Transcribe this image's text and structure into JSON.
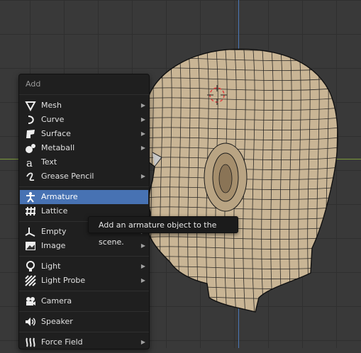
{
  "menu": {
    "title": "Add",
    "items": [
      {
        "label": "Mesh",
        "icon": "mesh-icon",
        "submenu": true
      },
      {
        "label": "Curve",
        "icon": "curve-icon",
        "submenu": true
      },
      {
        "label": "Surface",
        "icon": "surface-icon",
        "submenu": true
      },
      {
        "label": "Metaball",
        "icon": "metaball-icon",
        "submenu": true
      },
      {
        "label": "Text",
        "icon": "text-icon",
        "submenu": false
      },
      {
        "label": "Grease Pencil",
        "icon": "grease-pencil-icon",
        "submenu": true
      },
      {
        "label": "Armature",
        "icon": "armature-icon",
        "submenu": false,
        "selected": true
      },
      {
        "label": "Lattice",
        "icon": "lattice-icon",
        "submenu": false
      },
      {
        "label": "Empty",
        "icon": "empty-icon",
        "submenu": true
      },
      {
        "label": "Image",
        "icon": "image-icon",
        "submenu": true
      },
      {
        "label": "Light",
        "icon": "light-icon",
        "submenu": true
      },
      {
        "label": "Light Probe",
        "icon": "light-probe-icon",
        "submenu": true
      },
      {
        "label": "Camera",
        "icon": "camera-icon",
        "submenu": false
      },
      {
        "label": "Speaker",
        "icon": "speaker-icon",
        "submenu": false
      },
      {
        "label": "Force Field",
        "icon": "force-field-icon",
        "submenu": true
      }
    ]
  },
  "tooltip": {
    "text": "Add an armature object to the scene."
  },
  "colors": {
    "selected": "#4772b3",
    "menu_bg": "#1f1f1f",
    "head_fill": "#c9b595",
    "wire": "#1a1a1a"
  }
}
